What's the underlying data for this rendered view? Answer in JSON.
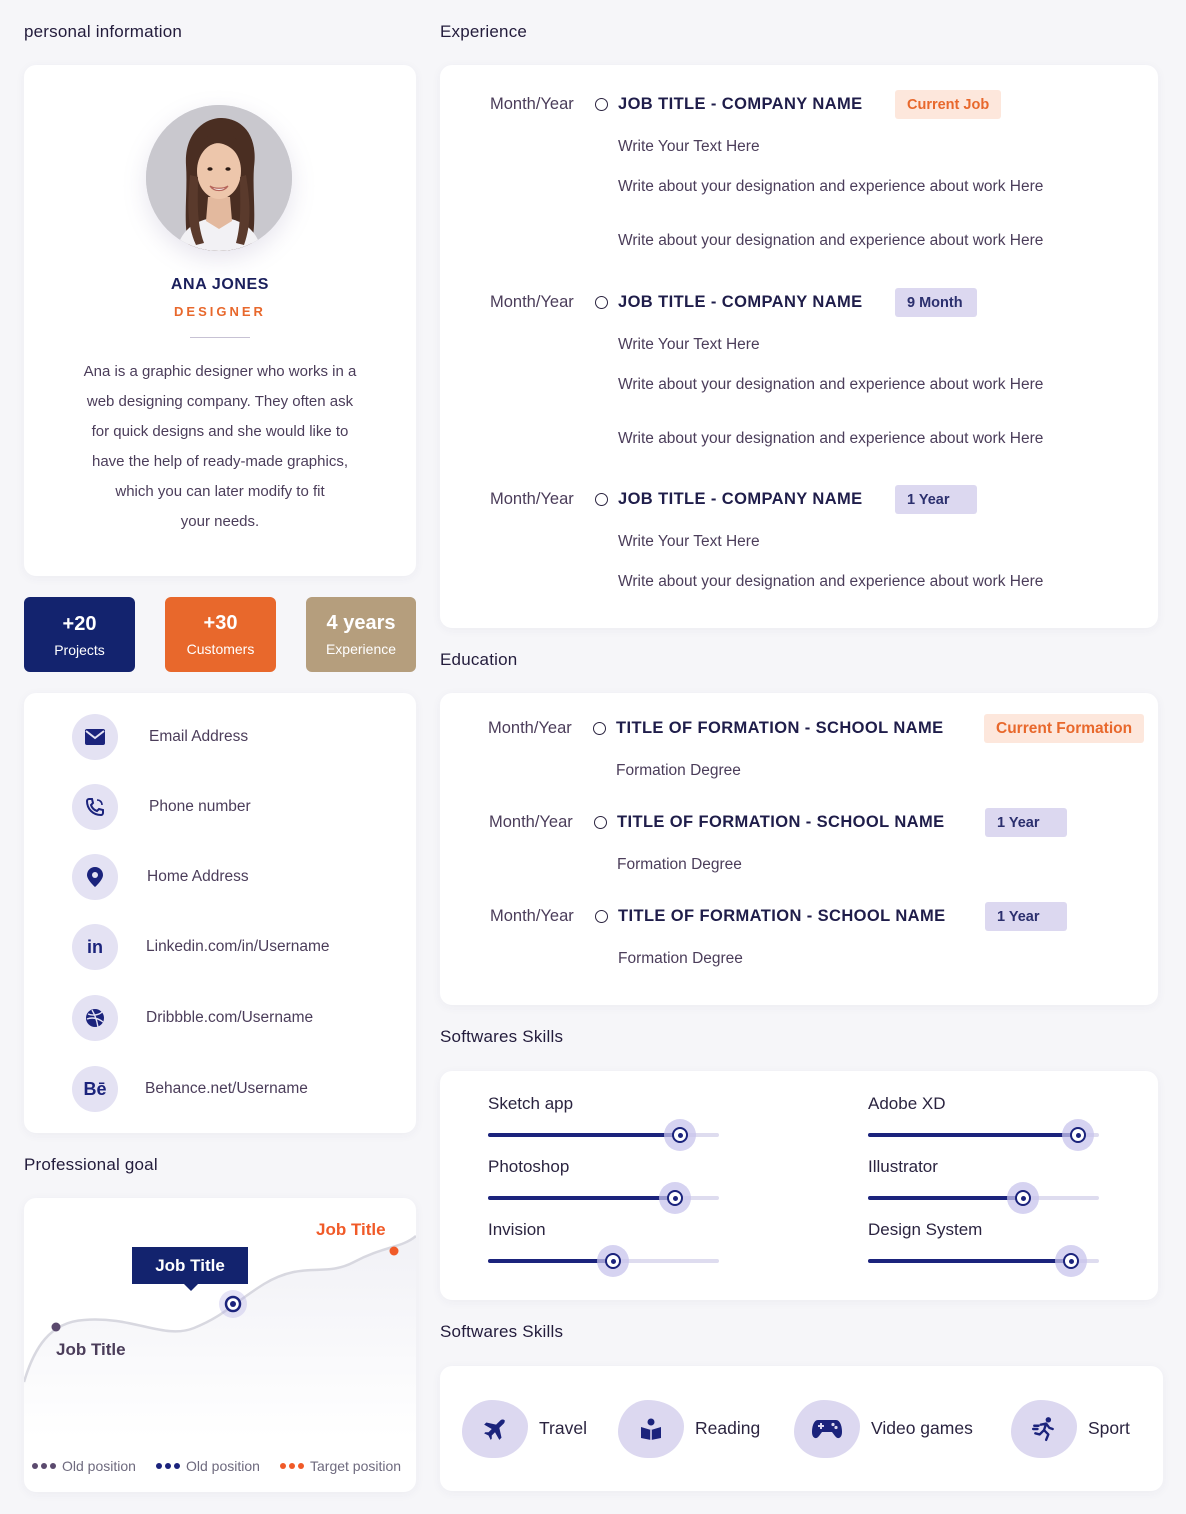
{
  "sections": {
    "personal": "personal information",
    "experience": "Experience",
    "education": "Education",
    "software_skills": "Softwares Skills",
    "professional_goal": "Professional goal",
    "hobbies": "Softwares Skills"
  },
  "profile": {
    "name": "ANA JONES",
    "role": "DESIGNER",
    "bio_lines": [
      "Ana is a graphic designer who works in a",
      "web designing company. They often ask",
      "for quick designs and she would like to",
      "have the help of ready-made graphics,",
      "which you can later modify  to fit",
      "your needs."
    ]
  },
  "stats": [
    {
      "value": "+20",
      "label": "Projects",
      "color": "#13236e"
    },
    {
      "value": "+30",
      "label": "Customers",
      "color": "#e8682c"
    },
    {
      "value": "4 years",
      "label": "Experience",
      "color": "#b59e7d"
    }
  ],
  "contacts": [
    {
      "icon": "envelope-icon",
      "text": "Email Address"
    },
    {
      "icon": "phone-icon",
      "text": "Phone number"
    },
    {
      "icon": "map-pin-icon",
      "text": "Home Address"
    },
    {
      "icon": "linkedin-icon",
      "text": "Linkedin.com/in/Username"
    },
    {
      "icon": "dribbble-icon",
      "text": "Dribbble.com/Username"
    },
    {
      "icon": "behance-icon",
      "text": "Behance.net/Username"
    }
  ],
  "experience": [
    {
      "date": "Month/Year",
      "title": "JOB TITLE - COMPANY NAME",
      "badge": "Current Job",
      "lines": [
        "Write Your Text Here",
        "Write about your designation and experience about work Here",
        "Write about your designation and experience about work Here"
      ]
    },
    {
      "date": "Month/Year",
      "title": "JOB TITLE - COMPANY NAME",
      "badge": "9 Month",
      "lines": [
        "Write Your Text Here",
        "Write about your designation and experience about work Here",
        "Write about your designation and experience about work Here"
      ]
    },
    {
      "date": "Month/Year",
      "title": "JOB TITLE - COMPANY NAME",
      "badge": "1 Year",
      "lines": [
        "Write Your Text Here",
        "Write about your designation and experience about work Here"
      ]
    }
  ],
  "education": [
    {
      "date": "Month/Year",
      "title": "TITLE  OF FORMATION - SCHOOL NAME",
      "badge": "Current Formation",
      "degree": "Formation Degree"
    },
    {
      "date": "Month/Year",
      "title": "TITLE  OF FORMATION - SCHOOL NAME",
      "badge": "1 Year",
      "degree": "Formation Degree"
    },
    {
      "date": "Month/Year",
      "title": "TITLE  OF FORMATION - SCHOOL NAME",
      "badge": "1 Year",
      "degree": "Formation Degree"
    }
  ],
  "skills": [
    {
      "name": "Sketch app",
      "level": 0.83
    },
    {
      "name": "Adobe XD",
      "level": 0.91
    },
    {
      "name": "Photoshop",
      "level": 0.81
    },
    {
      "name": "Illustrator",
      "level": 0.67
    },
    {
      "name": "Invision",
      "level": 0.54
    },
    {
      "name": "Design System",
      "level": 0.88
    }
  ],
  "goal": {
    "labels": {
      "start": "Job Title",
      "current": "Job Title",
      "target": "Job Title"
    },
    "legend": [
      {
        "label": "Old position",
        "color": "#5b4a6e"
      },
      {
        "label": "Old position",
        "color": "#1b237c"
      },
      {
        "label": "Target position",
        "color": "#f05a28"
      }
    ]
  },
  "hobbies": [
    {
      "icon": "airplane-icon",
      "label": "Travel"
    },
    {
      "icon": "reading-icon",
      "label": "Reading"
    },
    {
      "icon": "gamepad-icon",
      "label": "Video games"
    },
    {
      "icon": "running-icon",
      "label": "Sport"
    }
  ]
}
